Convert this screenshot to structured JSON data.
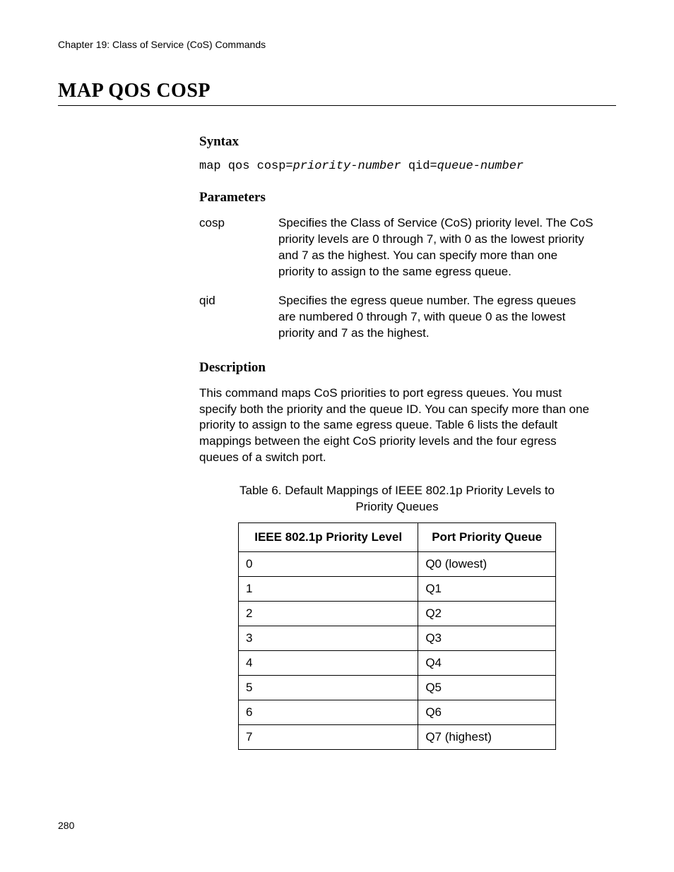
{
  "chapter": "Chapter 19: Class of Service (CoS) Commands",
  "title": "MAP QOS COSP",
  "sections": {
    "syntax_heading": "Syntax",
    "parameters_heading": "Parameters",
    "description_heading": "Description"
  },
  "syntax": {
    "prefix": "map qos cosp=",
    "arg1": "priority-number",
    "mid": " qid=",
    "arg2": "queue-number"
  },
  "parameters": [
    {
      "name": "cosp",
      "desc": "Specifies the Class of Service (CoS) priority level. The CoS priority levels are 0 through 7, with 0 as the lowest priority and 7 as the highest. You can specify more than one priority to assign to the same egress queue."
    },
    {
      "name": "qid",
      "desc": "Specifies the egress queue number. The egress queues are numbered 0 through 7, with queue 0 as the lowest priority and 7 as the highest."
    }
  ],
  "description_text": "This command maps CoS priorities to port egress queues. You must specify both the priority and the queue ID. You can specify more than one priority to assign to the same egress queue. Table 6 lists the default mappings between the eight CoS priority levels and the four egress queues of a switch port.",
  "table": {
    "caption": "Table 6. Default Mappings of IEEE 802.1p Priority Levels to Priority Queues",
    "headers": [
      "IEEE 802.1p Priority Level",
      "Port Priority Queue"
    ],
    "rows": [
      [
        "0",
        "Q0 (lowest)"
      ],
      [
        "1",
        "Q1"
      ],
      [
        "2",
        "Q2"
      ],
      [
        "3",
        "Q3"
      ],
      [
        "4",
        "Q4"
      ],
      [
        "5",
        "Q5"
      ],
      [
        "6",
        "Q6"
      ],
      [
        "7",
        "Q7 (highest)"
      ]
    ]
  },
  "page_number": "280"
}
